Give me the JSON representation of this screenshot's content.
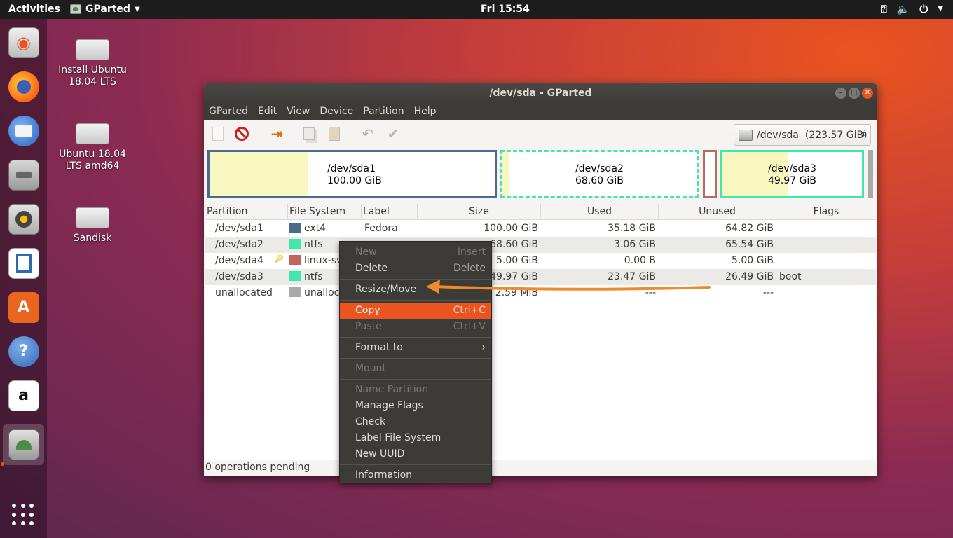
{
  "topbar": {
    "activities": "Activities",
    "app_name": "GParted",
    "clock": "Fri 15:54"
  },
  "dock": {
    "items": [
      {
        "name": "install-ubuntu"
      },
      {
        "name": "firefox"
      },
      {
        "name": "thunderbird"
      },
      {
        "name": "files"
      },
      {
        "name": "rhythmbox"
      },
      {
        "name": "libreoffice-writer"
      },
      {
        "name": "ubuntu-software"
      },
      {
        "name": "help"
      },
      {
        "name": "amazon"
      },
      {
        "name": "gparted"
      }
    ]
  },
  "desktop": {
    "icons": [
      {
        "label": "Install Ubuntu 18.04 LTS"
      },
      {
        "label": "Ubuntu 18.04 LTS amd64"
      },
      {
        "label": "Sandisk"
      }
    ]
  },
  "window": {
    "title": "/dev/sda - GParted",
    "menu": [
      "GParted",
      "Edit",
      "View",
      "Device",
      "Partition",
      "Help"
    ],
    "device_selector": "/dev/sda  (223.57 GiB)",
    "map": [
      {
        "name": "/dev/sda1",
        "size": "100.00 GiB"
      },
      {
        "name": "/dev/sda2",
        "size": "68.60 GiB"
      },
      {
        "name": "/dev/sda3",
        "size": "49.97 GiB"
      }
    ],
    "columns": [
      "Partition",
      "File System",
      "Label",
      "Size",
      "Used",
      "Unused",
      "Flags"
    ],
    "rows": [
      {
        "partition": "/dev/sda1",
        "fs": "ext4",
        "fs_color": "#4b6a8c",
        "label": "Fedora",
        "size": "100.00 GiB",
        "used": "35.18 GiB",
        "unused": "64.82 GiB",
        "flags": ""
      },
      {
        "partition": "/dev/sda2",
        "fs": "ntfs",
        "fs_color": "#42e5ac",
        "label": "",
        "size": "68.60 GiB",
        "used": "3.06 GiB",
        "unused": "65.54 GiB",
        "flags": ""
      },
      {
        "partition": "/dev/sda4",
        "fs": "linux-swap",
        "fs_color": "#c1665a",
        "label": "",
        "size": "5.00 GiB",
        "used": "0.00 B",
        "unused": "5.00 GiB",
        "flags": ""
      },
      {
        "partition": "/dev/sda3",
        "fs": "ntfs",
        "fs_color": "#42e5ac",
        "label": "",
        "size": "49.97 GiB",
        "used": "23.47 GiB",
        "unused": "26.49 GiB",
        "flags": "boot"
      },
      {
        "partition": "unallocated",
        "fs": "unallocated",
        "fs_color": "#a9a9a9",
        "label": "",
        "size": "2.59 MiB",
        "used": "---",
        "unused": "---",
        "flags": ""
      }
    ],
    "status": "0 operations pending"
  },
  "context_menu": {
    "new": {
      "label": "New",
      "accel": "Insert"
    },
    "delete": {
      "label": "Delete",
      "accel": "Delete"
    },
    "resize": {
      "label": "Resize/Move"
    },
    "copy": {
      "label": "Copy",
      "accel": "Ctrl+C"
    },
    "paste": {
      "label": "Paste",
      "accel": "Ctrl+V"
    },
    "format": {
      "label": "Format to",
      "arrow": "›"
    },
    "mount": {
      "label": "Mount"
    },
    "name_partition": {
      "label": "Name Partition"
    },
    "manage_flags": {
      "label": "Manage Flags"
    },
    "check": {
      "label": "Check"
    },
    "label_fs": {
      "label": "Label File System"
    },
    "new_uuid": {
      "label": "New UUID"
    },
    "information": {
      "label": "Information"
    }
  },
  "colors": {
    "accent": "#e95420",
    "annotation_arrow": "#f08a2a"
  }
}
